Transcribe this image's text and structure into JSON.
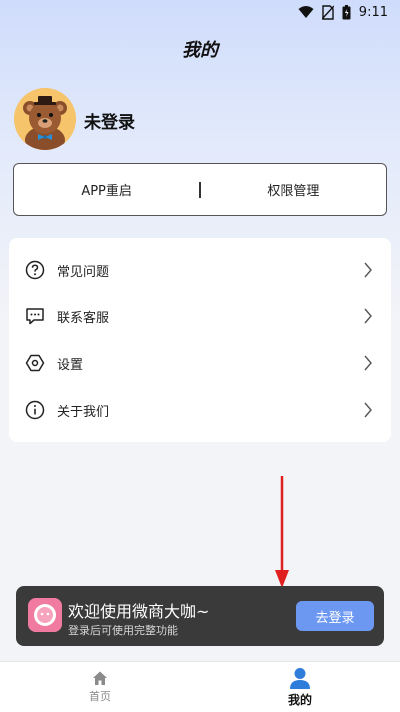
{
  "status_bar": {
    "time": "9:11"
  },
  "header": {
    "title": "我的"
  },
  "profile": {
    "name": "未登录"
  },
  "actions": {
    "restart_label": "APP重启",
    "permission_label": "权限管理"
  },
  "menu": {
    "items": [
      {
        "label": "常见问题",
        "icon": "question-circle-icon"
      },
      {
        "label": "联系客服",
        "icon": "chat-bubble-icon"
      },
      {
        "label": "设置",
        "icon": "hexagon-settings-icon"
      },
      {
        "label": "关于我们",
        "icon": "info-circle-icon"
      }
    ]
  },
  "toast": {
    "title": "欢迎使用微商大咖~",
    "subtitle": "登录后可使用完整功能",
    "button_label": "去登录"
  },
  "tabbar": {
    "tabs": [
      {
        "label": "首页",
        "icon": "home-icon",
        "active": false
      },
      {
        "label": "我的",
        "icon": "person-icon",
        "active": true
      }
    ]
  },
  "colors": {
    "accent": "#6d98f2",
    "toast_bg": "#3a3a3b",
    "annotation": "#e02020",
    "tab_active": "#2f7ddb"
  }
}
